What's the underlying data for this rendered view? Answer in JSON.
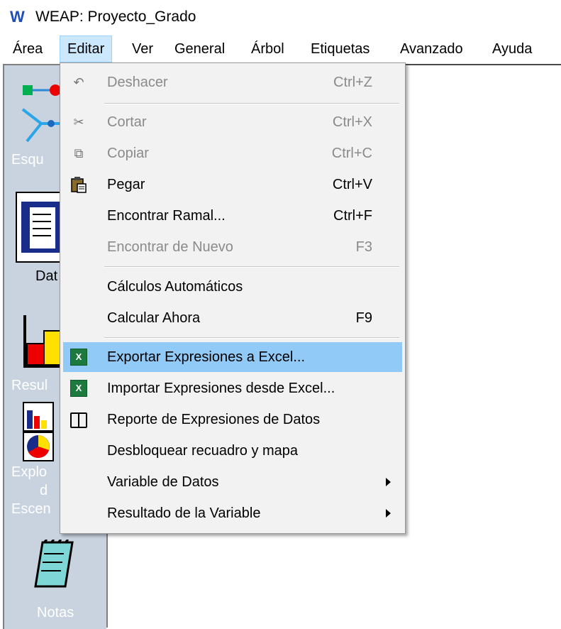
{
  "window": {
    "title": "WEAP: Proyecto_Grado",
    "logo": "W"
  },
  "menubar": [
    "Área",
    "Editar",
    "Ver",
    "General",
    "Árbol",
    "Etiquetas",
    "Avanzado",
    "Ayuda"
  ],
  "active_menu": "Editar",
  "sidebar": {
    "items": [
      {
        "label": "Esqu",
        "icon": "schematic-icon"
      },
      {
        "label": "Dat",
        "icon": "data-icon"
      },
      {
        "label": "Resul",
        "icon": "results-icon"
      },
      {
        "label": "Explo",
        "label2": "d",
        "label3": "Escen",
        "icon": "scenario-explorer-icon"
      },
      {
        "label": "Notas",
        "icon": "notes-icon"
      }
    ]
  },
  "dropdown": {
    "items": [
      {
        "label": "Deshacer",
        "shortcut": "Ctrl+Z",
        "disabled": true,
        "icon": "undo-icon"
      },
      {
        "label": "Cortar",
        "shortcut": "Ctrl+X",
        "disabled": true,
        "icon": "scissors-icon"
      },
      {
        "label": "Copiar",
        "shortcut": "Ctrl+C",
        "disabled": true,
        "icon": "copy-icon"
      },
      {
        "label": "Pegar",
        "shortcut": "Ctrl+V",
        "disabled": false,
        "icon": "paste-icon"
      },
      {
        "label": "Encontrar Ramal...",
        "shortcut": "Ctrl+F",
        "disabled": false
      },
      {
        "label": "Encontrar de Nuevo",
        "shortcut": "F3",
        "disabled": true
      },
      {
        "label": "Cálculos Automáticos",
        "shortcut": "",
        "disabled": false
      },
      {
        "label": "Calcular Ahora",
        "shortcut": "F9",
        "disabled": false
      },
      {
        "label": "Exportar Expresiones a Excel...",
        "shortcut": "",
        "disabled": false,
        "icon": "excel-icon",
        "highlighted": true
      },
      {
        "label": "Importar Expresiones desde Excel...",
        "shortcut": "",
        "disabled": false,
        "icon": "excel-icon"
      },
      {
        "label": "Reporte de Expresiones de Datos",
        "shortcut": "",
        "disabled": false,
        "icon": "book-icon"
      },
      {
        "label": "Desbloquear recuadro y mapa",
        "shortcut": "",
        "disabled": false
      },
      {
        "label": "Variable de Datos",
        "shortcut": "",
        "disabled": false,
        "submenu": true
      },
      {
        "label": "Resultado de la Variable",
        "shortcut": "",
        "disabled": false,
        "submenu": true
      }
    ]
  },
  "colors": {
    "highlight": "#91c9f7",
    "active_menu": "#cce8ff",
    "sidebar": "#c9d3e0",
    "disabled_text": "#8a8a8a"
  }
}
